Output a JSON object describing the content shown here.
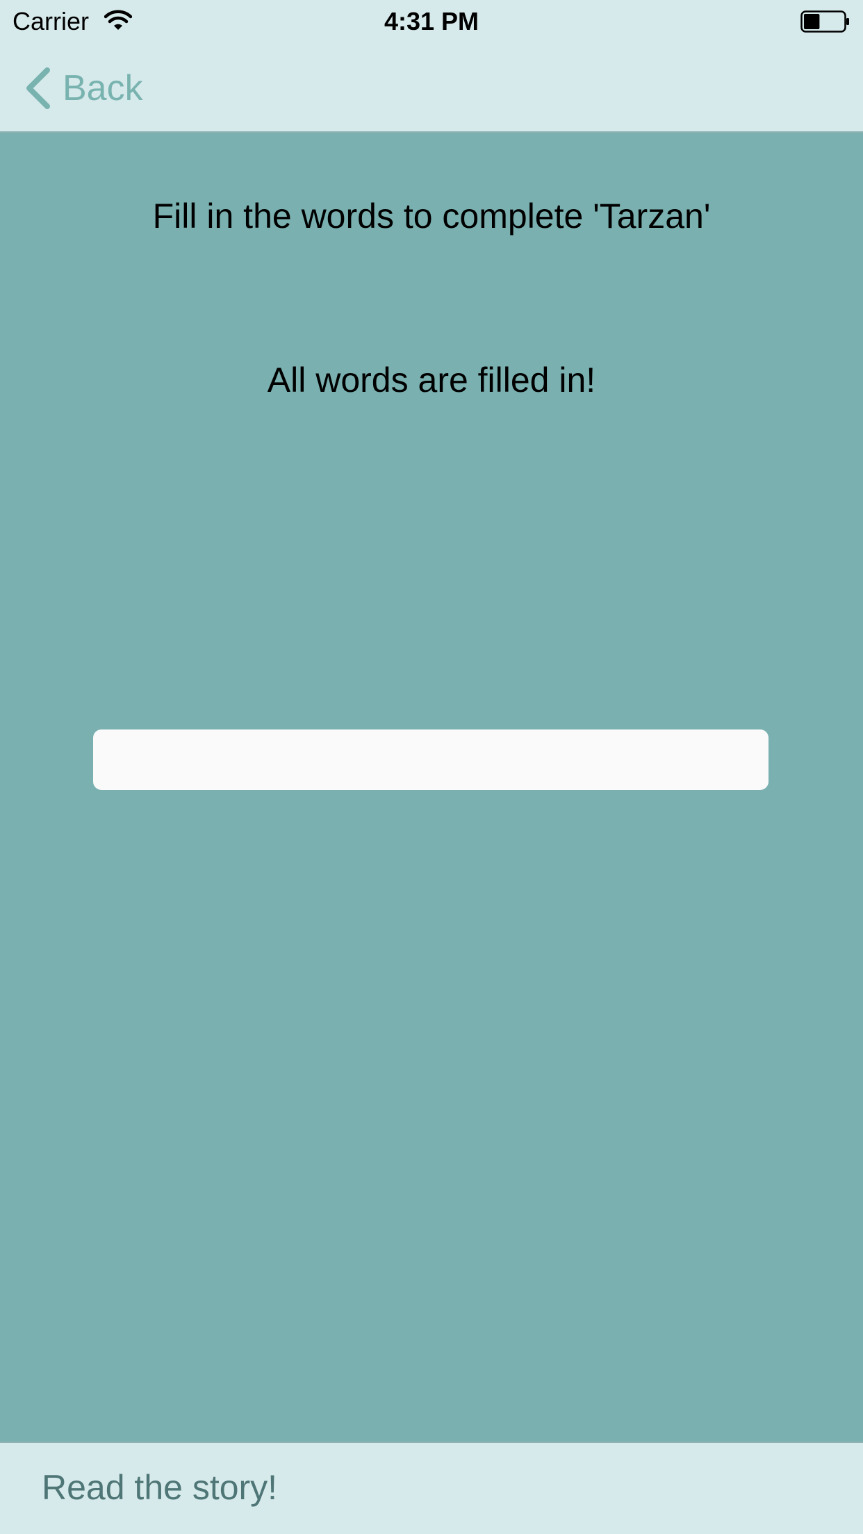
{
  "status_bar": {
    "carrier": "Carrier",
    "time": "4:31 PM",
    "battery_level": 0.4
  },
  "nav": {
    "back_label": "Back"
  },
  "main": {
    "title": "Fill in the words to complete 'Tarzan'",
    "message": "All words are filled in!",
    "input": {
      "value": "",
      "placeholder": ""
    }
  },
  "bottom": {
    "read_story_label": "Read the story!"
  },
  "colors": {
    "background": "#7ab0b0",
    "bars": "#d7eaeb",
    "accent": "#79b3b0",
    "input_background": "#fafafa"
  }
}
